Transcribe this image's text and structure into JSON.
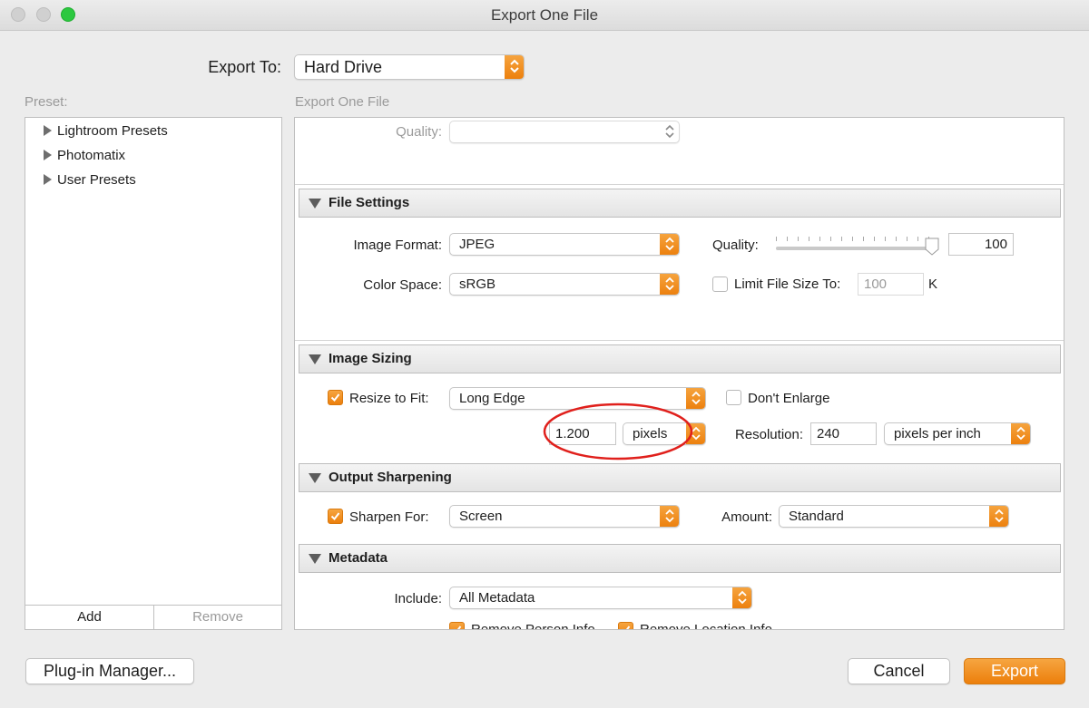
{
  "window": {
    "title": "Export One File"
  },
  "export_to": {
    "label": "Export To:",
    "value": "Hard Drive"
  },
  "preset": {
    "label": "Preset:",
    "items": [
      "Lightroom Presets",
      "Photomatix",
      "User Presets"
    ],
    "add_label": "Add",
    "remove_label": "Remove"
  },
  "main": {
    "header": "Export One File",
    "quality_top": {
      "label": "Quality:",
      "value": ""
    },
    "file_settings": {
      "title": "File Settings",
      "image_format_label": "Image Format:",
      "image_format_value": "JPEG",
      "quality_label": "Quality:",
      "quality_value": "100",
      "quality_fraction": 1.0,
      "color_space_label": "Color Space:",
      "color_space_value": "sRGB",
      "limit_label": "Limit File Size To:",
      "limit_value": "100",
      "limit_unit": "K",
      "limit_checked": false
    },
    "image_sizing": {
      "title": "Image Sizing",
      "resize_label": "Resize to Fit:",
      "resize_checked": true,
      "resize_value": "Long Edge",
      "dont_enlarge_label": "Don't Enlarge",
      "dont_enlarge_checked": false,
      "size_value": "1.200",
      "size_unit": "pixels",
      "resolution_label": "Resolution:",
      "resolution_value": "240",
      "resolution_unit": "pixels per inch"
    },
    "output_sharpening": {
      "title": "Output Sharpening",
      "sharpen_label": "Sharpen For:",
      "sharpen_checked": true,
      "sharpen_value": "Screen",
      "amount_label": "Amount:",
      "amount_value": "Standard"
    },
    "metadata": {
      "title": "Metadata",
      "include_label": "Include:",
      "include_value": "All Metadata",
      "remove_person_label": "Remove Person Info",
      "remove_location_label": "Remove Location Info"
    }
  },
  "footer": {
    "plugin_manager_label": "Plug-in Manager...",
    "cancel_label": "Cancel",
    "export_label": "Export"
  },
  "colors": {
    "accent": "#ef8a1c",
    "annotation": "#e0201c",
    "close_green": "#2cc840"
  }
}
